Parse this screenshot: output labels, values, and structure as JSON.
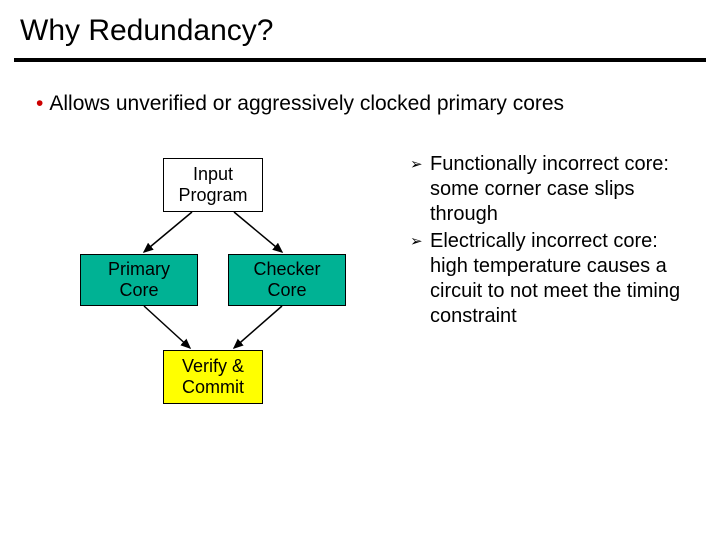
{
  "title": "Why Redundancy?",
  "bullet": {
    "marker": "•",
    "text": "Allows unverified or aggressively clocked primary cores"
  },
  "diagram": {
    "input_box": "Input\nProgram",
    "primary_box": "Primary\nCore",
    "checker_box": "Checker\nCore",
    "verify_box": "Verify &\nCommit"
  },
  "right_list": {
    "marker": "➢",
    "items": [
      "Functionally incorrect core: some corner case slips through",
      "Electrically incorrect core: high temperature causes a circuit to not meet the timing constraint"
    ]
  }
}
